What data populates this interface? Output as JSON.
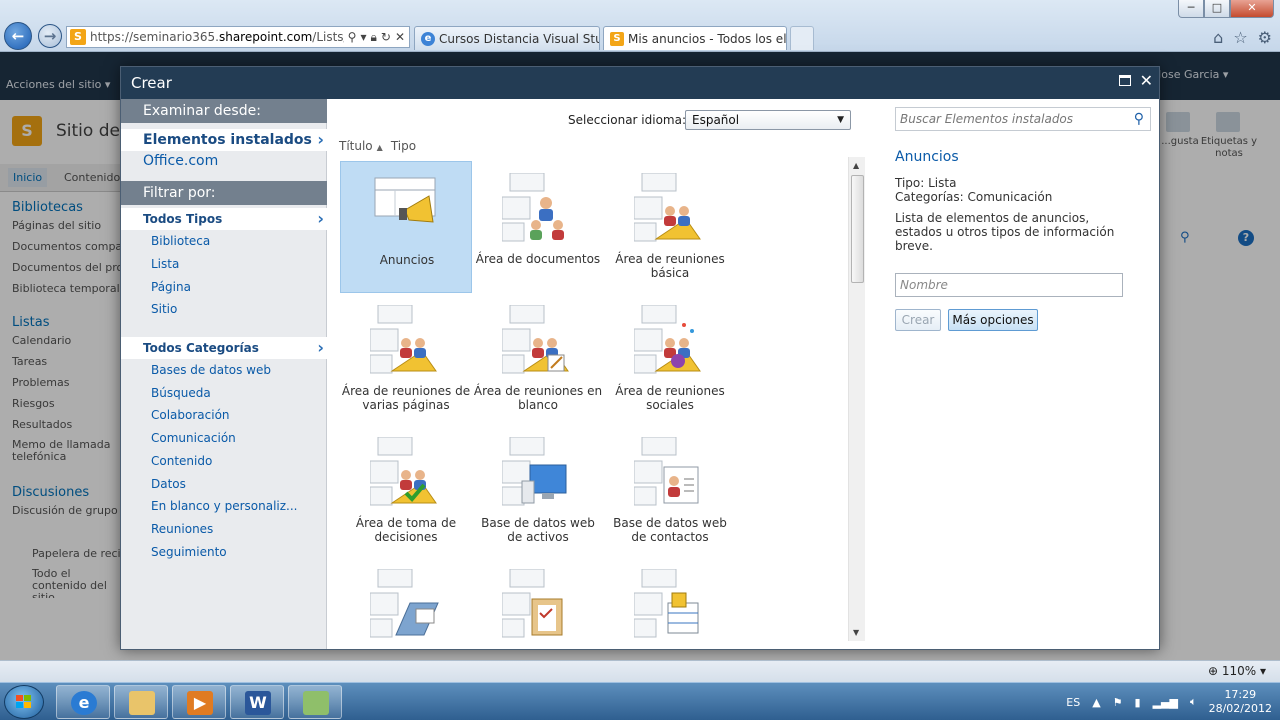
{
  "browser": {
    "url_prefix": "https://seminario365.",
    "url_domain": "sharepoint.com",
    "url_rest": "/Lists/Mis%",
    "tabs": [
      {
        "label": "Cursos Distancia Visual Studio ..."
      },
      {
        "label": "Mis anuncios - Todos los el..."
      }
    ],
    "window_buttons": [
      "─",
      "□",
      "✕"
    ]
  },
  "sharepoint": {
    "site_actions": "Acciones del sitio ▾",
    "user": "Jose Garcia ▾",
    "site_title": "Sitio de",
    "nav": {
      "inicio": "Inicio",
      "contenido": "Contenido"
    },
    "quick_launch": [
      {
        "heading": "Bibliotecas",
        "items": [
          "Páginas del sitio",
          "Documentos compa",
          "Documentos del pro",
          "Biblioteca temporal"
        ]
      },
      {
        "heading": "Listas",
        "items": [
          "Calendario",
          "Tareas",
          "Problemas",
          "Riesgos",
          "Resultados",
          "Memo de llamada telefónica"
        ]
      },
      {
        "heading": "Discusiones",
        "items": [
          "Discusión de grupo"
        ]
      }
    ],
    "footer_links": [
      "Papelera de reci",
      "Todo el contenido del sitio"
    ],
    "ribbon_right": {
      "item1": "...gusta",
      "item2": "Etiquetas y notas"
    }
  },
  "dialog": {
    "title": "Crear",
    "browse_from_heading": "Examinar desde:",
    "installed_items": "Elementos instalados",
    "office_com": "Office.com",
    "filter_heading": "Filtrar por:",
    "all_types": "Todos Tipos",
    "types": [
      "Biblioteca",
      "Lista",
      "Página",
      "Sitio"
    ],
    "all_categories": "Todos Categorías",
    "categories": [
      "Bases de datos web",
      "Búsqueda",
      "Colaboración",
      "Comunicación",
      "Contenido",
      "Datos",
      "En blanco y personaliz...",
      "Reuniones",
      "Seguimiento"
    ],
    "language_label": "Seleccionar idioma:",
    "language_value": "Español",
    "sort_title": "Título",
    "sort_type": "Tipo",
    "templates": [
      {
        "label": "Anuncios",
        "selected": true
      },
      {
        "label": "Área de documentos",
        "selected": false
      },
      {
        "label": "Área de reuniones básica",
        "selected": false
      },
      {
        "label": "Área de reuniones de varias páginas",
        "selected": false
      },
      {
        "label": "Área de reuniones en blanco",
        "selected": false
      },
      {
        "label": "Área de reuniones sociales",
        "selected": false
      },
      {
        "label": "Área de toma de decisiones",
        "selected": false
      },
      {
        "label": "Base de datos web de activos",
        "selected": false
      },
      {
        "label": "Base de datos web de contactos",
        "selected": false
      },
      {
        "label": "",
        "selected": false
      },
      {
        "label": "",
        "selected": false
      },
      {
        "label": "",
        "selected": false
      }
    ],
    "search_placeholder": "Buscar Elementos instalados",
    "details": {
      "title": "Anuncios",
      "type_line": "Tipo: Lista",
      "categories_line": "Categorías: Comunicación",
      "description": "Lista de elementos de anuncios, estados u otros tipos de información breve."
    },
    "name_placeholder": "Nombre",
    "create_button": "Crear",
    "more_options_button": "Más opciones"
  },
  "statusbar": {
    "zoom": "110%"
  },
  "taskbar": {
    "language": "ES",
    "time": "17:29",
    "date": "28/02/2012"
  },
  "colors": {
    "dialog_title_bg": "#233c54",
    "left_heading_bg": "#73808e",
    "link": "#0a5aa8",
    "selected_tile": "#bfdcf4"
  }
}
